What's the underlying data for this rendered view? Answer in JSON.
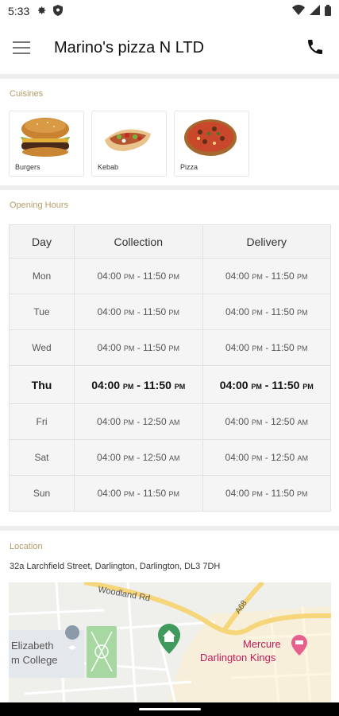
{
  "status": {
    "time": "5:33"
  },
  "appbar": {
    "title": "Marino's pizza N LTD"
  },
  "cuisines": {
    "label": "Cuisines",
    "items": [
      {
        "name": "Burgers"
      },
      {
        "name": "Kebab"
      },
      {
        "name": "Pizza"
      }
    ]
  },
  "hours": {
    "label": "Opening Hours",
    "headers": {
      "day": "Day",
      "collection": "Collection",
      "delivery": "Delivery"
    },
    "rows": [
      {
        "day": "Mon",
        "c_open": "04:00",
        "c_open_ap": "PM",
        "c_close": "11:50",
        "c_close_ap": "PM",
        "d_open": "04:00",
        "d_open_ap": "PM",
        "d_close": "11:50",
        "d_close_ap": "PM"
      },
      {
        "day": "Tue",
        "c_open": "04:00",
        "c_open_ap": "PM",
        "c_close": "11:50",
        "c_close_ap": "PM",
        "d_open": "04:00",
        "d_open_ap": "PM",
        "d_close": "11:50",
        "d_close_ap": "PM"
      },
      {
        "day": "Wed",
        "c_open": "04:00",
        "c_open_ap": "PM",
        "c_close": "11:50",
        "c_close_ap": "PM",
        "d_open": "04:00",
        "d_open_ap": "PM",
        "d_close": "11:50",
        "d_close_ap": "PM"
      },
      {
        "day": "Thu",
        "c_open": "04:00",
        "c_open_ap": "PM",
        "c_close": "11:50",
        "c_close_ap": "PM",
        "d_open": "04:00",
        "d_open_ap": "PM",
        "d_close": "11:50",
        "d_close_ap": "PM"
      },
      {
        "day": "Fri",
        "c_open": "04:00",
        "c_open_ap": "PM",
        "c_close": "12:50",
        "c_close_ap": "AM",
        "d_open": "04:00",
        "d_open_ap": "PM",
        "d_close": "12:50",
        "d_close_ap": "AM"
      },
      {
        "day": "Sat",
        "c_open": "04:00",
        "c_open_ap": "PM",
        "c_close": "12:50",
        "c_close_ap": "AM",
        "d_open": "04:00",
        "d_open_ap": "PM",
        "d_close": "12:50",
        "d_close_ap": "AM"
      },
      {
        "day": "Sun",
        "c_open": "04:00",
        "c_open_ap": "PM",
        "c_close": "11:50",
        "c_close_ap": "PM",
        "d_open": "04:00",
        "d_open_ap": "PM",
        "d_close": "11:50",
        "d_close_ap": "PM"
      }
    ],
    "separator": "-"
  },
  "location": {
    "label": "Location",
    "address": "32a Larchfield Street, Darlington, Darlington, DL3 7DH"
  },
  "map": {
    "road_woodland": "Woodland Rd",
    "road_a68": "A68",
    "poi_college_line1": "Elizabeth",
    "poi_college_line2": "m College",
    "poi_hotel_line1": "Mercure",
    "poi_hotel_line2": "Darlington Kings"
  },
  "colors": {
    "section_label": "#b49d6a",
    "map_road_yellow": "#f5d67a",
    "hotel_pin": "#e75f8d",
    "home_pin": "#3f9a5c",
    "college_pin": "#8a9aa8"
  }
}
